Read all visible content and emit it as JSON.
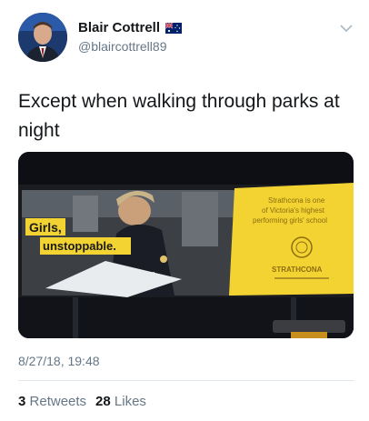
{
  "author": {
    "display_name": "Blair Cottrell",
    "handle": "@blaircottrell89",
    "flag_icon": "australia-flag-icon"
  },
  "tweet": {
    "text": "Except when walking through parks at night",
    "timestamp": "8/27/18, 19:48"
  },
  "media": {
    "billboard_left_text_1": "Girls,",
    "billboard_left_text_2": "unstoppable.",
    "billboard_right_text_1": "Strathcona is one",
    "billboard_right_text_2": "of Victoria's highest",
    "billboard_right_text_3": "performing girls' school",
    "billboard_brand": "STRATHCONA",
    "colors": {
      "billboard_yellow": "#f3d332",
      "night_sky": "#0d0f14"
    }
  },
  "stats": {
    "retweets_count": "3",
    "retweets_label": "Retweets",
    "likes_count": "28",
    "likes_label": "Likes"
  },
  "colors": {
    "text_primary": "#14171a",
    "text_secondary": "#657786",
    "divider": "#e1e8ed"
  }
}
